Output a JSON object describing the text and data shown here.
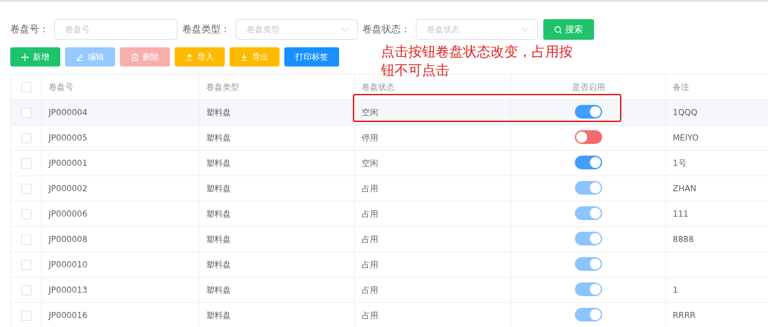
{
  "filters": [
    {
      "label": "卷盘号：",
      "kind": "input",
      "placeholder": "卷盘号"
    },
    {
      "label": "卷盘类型：",
      "kind": "select",
      "placeholder": "卷盘类型"
    },
    {
      "label": "卷盘状态：",
      "kind": "select",
      "placeholder": "卷盘状态"
    }
  ],
  "search_button": "搜索",
  "toolbar": [
    {
      "label": "新增",
      "kind": "add",
      "disabled": false
    },
    {
      "label": "编辑",
      "kind": "edit",
      "disabled": true
    },
    {
      "label": "删除",
      "kind": "delete",
      "disabled": true
    },
    {
      "label": "导入",
      "kind": "import",
      "disabled": false
    },
    {
      "label": "导出",
      "kind": "export",
      "disabled": false
    },
    {
      "label": "打印标签",
      "kind": "print",
      "disabled": false
    }
  ],
  "annotation": {
    "text": "点击按钮卷盘状态改变，占用按钮不可点击"
  },
  "table": {
    "select_all_checked": false,
    "columns": [
      "卷盘号",
      "卷盘类型",
      "卷盘状态",
      "是否启用",
      "备注"
    ],
    "rows": [
      {
        "checked": false,
        "highlighted": true,
        "annotated": true,
        "id": "JP000004",
        "type": "塑料盘",
        "status": "空闲",
        "enabled": {
          "on": true,
          "disabled": false
        },
        "remark": "1QQQ"
      },
      {
        "checked": false,
        "highlighted": false,
        "annotated": false,
        "id": "JP000005",
        "type": "塑料盘",
        "status": "停用",
        "enabled": {
          "on": false,
          "disabled": false
        },
        "remark": "MEIYO"
      },
      {
        "checked": false,
        "highlighted": false,
        "annotated": false,
        "id": "JP000001",
        "type": "塑料盘",
        "status": "空闲",
        "enabled": {
          "on": true,
          "disabled": false
        },
        "remark": "1号"
      },
      {
        "checked": false,
        "highlighted": false,
        "annotated": false,
        "id": "JP000002",
        "type": "塑料盘",
        "status": "占用",
        "enabled": {
          "on": true,
          "disabled": true
        },
        "remark": "ZHAN"
      },
      {
        "checked": false,
        "highlighted": false,
        "annotated": false,
        "id": "JP000006",
        "type": "塑料盘",
        "status": "占用",
        "enabled": {
          "on": true,
          "disabled": true
        },
        "remark": "111"
      },
      {
        "checked": false,
        "highlighted": false,
        "annotated": false,
        "id": "JP000008",
        "type": "塑料盘",
        "status": "占用",
        "enabled": {
          "on": true,
          "disabled": true
        },
        "remark": "8888"
      },
      {
        "checked": false,
        "highlighted": false,
        "annotated": false,
        "id": "JP000010",
        "type": "塑料盘",
        "status": "占用",
        "enabled": {
          "on": true,
          "disabled": true
        }
      },
      {
        "checked": false,
        "highlighted": false,
        "annotated": false,
        "id": "JP000013",
        "type": "塑料盘",
        "status": "占用",
        "enabled": {
          "on": true,
          "disabled": true
        },
        "remark": "1"
      },
      {
        "checked": false,
        "highlighted": false,
        "annotated": false,
        "id": "JP000016",
        "type": "塑料盘",
        "status": "占用",
        "enabled": {
          "on": true,
          "disabled": true
        },
        "remark": "RRRR"
      }
    ]
  }
}
